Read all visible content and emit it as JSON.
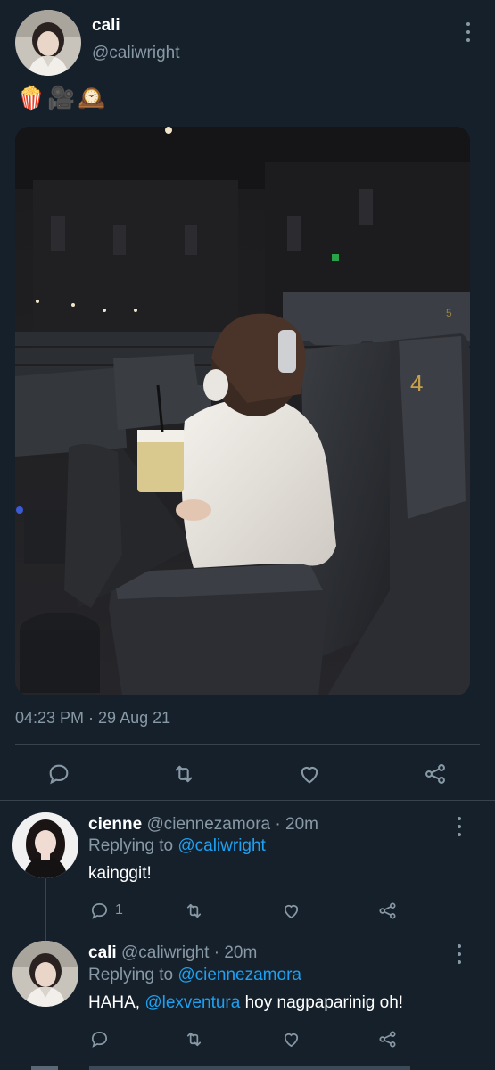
{
  "main_tweet": {
    "display_name": "cali",
    "handle": "@caliwright",
    "text_emojis": [
      "🍿",
      "🎥",
      "🕰️"
    ],
    "photo_description_icon": "movie-theater-photo",
    "timestamp": "04:23 PM · 29 Aug 21",
    "actions": [
      "reply-icon",
      "retweet-icon",
      "like-icon",
      "share-icon"
    ]
  },
  "photo": {
    "seat_numbers": [
      "4",
      "5"
    ]
  },
  "replies": [
    {
      "display_name": "cienne",
      "handle": "@ciennezamora",
      "time": "· 20m",
      "replying_label": "Replying to",
      "replying_to": "@caliwright",
      "text_before": "kainggit!",
      "mention": "",
      "text_after": "",
      "reply_count": "1",
      "retweet_count": "",
      "like_count": ""
    },
    {
      "display_name": "cali",
      "handle": "@caliwright",
      "time": "· 20m",
      "replying_label": "Replying to",
      "replying_to": "@ciennezamora",
      "text_before": "HAHA, ",
      "mention": "@lexventura",
      "text_after": " hoy nagpaparinig oh!",
      "reply_count": "",
      "retweet_count": "",
      "like_count": ""
    }
  ],
  "colors": {
    "background": "#15202b",
    "secondary_text": "#8899a6",
    "link": "#1da1f2",
    "divider": "#38444d"
  }
}
